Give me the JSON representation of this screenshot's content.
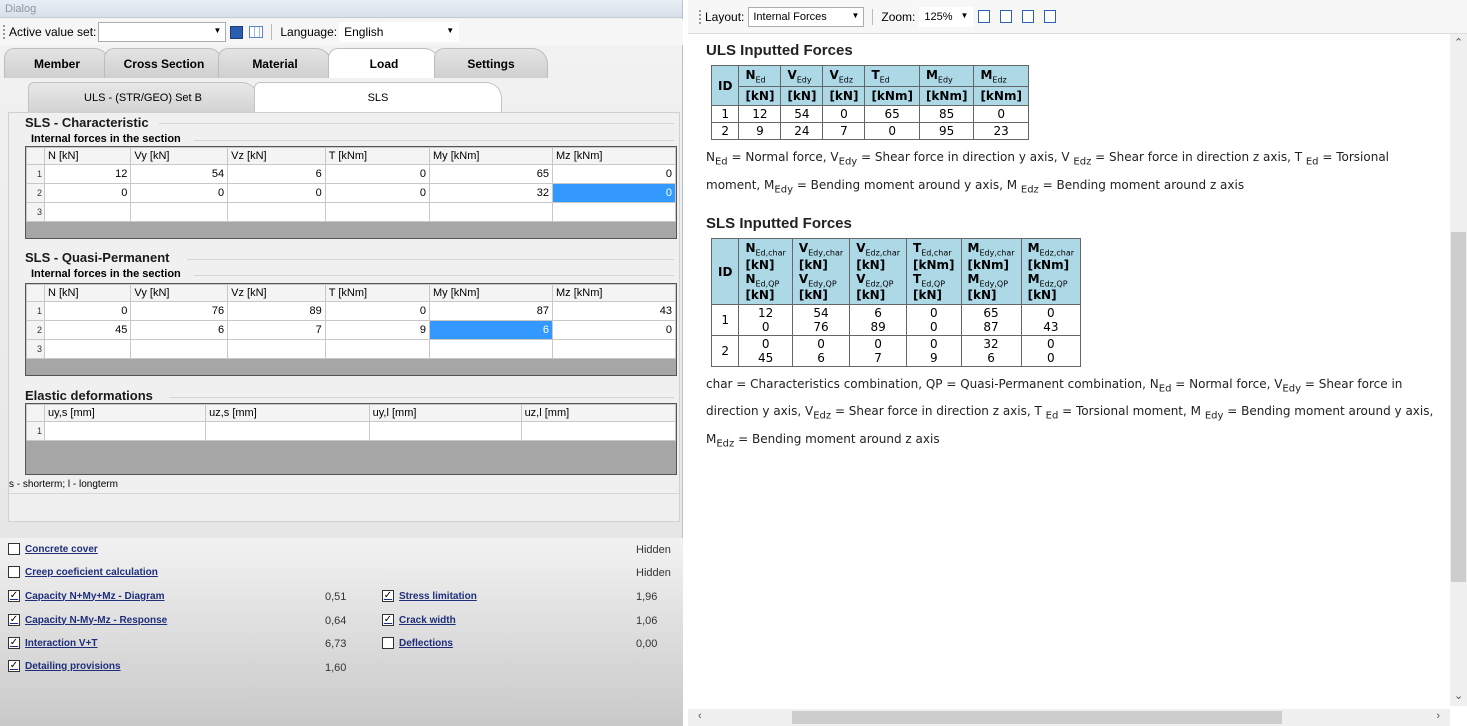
{
  "dialog_title": "Dialog",
  "toolbar": {
    "active_value_set_label": "Active value set:",
    "active_value_set": "",
    "language_label": "Language:",
    "language": "English"
  },
  "tabs": [
    "Member",
    "Cross Section",
    "Material",
    "Load",
    "Settings"
  ],
  "subtabs": [
    "ULS - (STR/GEO) Set B",
    "SLS"
  ],
  "sls_char": {
    "title": "SLS - Characteristic",
    "subtitle": "Internal forces in the section",
    "headers": [
      "N [kN]",
      "Vy [kN]",
      "Vz [kN]",
      "T [kNm]",
      "My [kNm]",
      "Mz [kNm]"
    ],
    "rows": [
      [
        "1",
        "12",
        "54",
        "6",
        "0",
        "65",
        "0"
      ],
      [
        "2",
        "0",
        "0",
        "0",
        "0",
        "32",
        "0"
      ],
      [
        "3",
        "",
        "",
        "",
        "",
        "",
        ""
      ]
    ]
  },
  "sls_qp": {
    "title": "SLS - Quasi-Permanent",
    "subtitle": "Internal forces in the section",
    "headers": [
      "N [kN]",
      "Vy [kN]",
      "Vz [kN]",
      "T [kNm]",
      "My [kNm]",
      "Mz [kNm]"
    ],
    "rows": [
      [
        "1",
        "0",
        "76",
        "89",
        "0",
        "87",
        "43"
      ],
      [
        "2",
        "45",
        "6",
        "7",
        "9",
        "6",
        "0"
      ],
      [
        "3",
        "",
        "",
        "",
        "",
        "",
        ""
      ]
    ]
  },
  "elastic": {
    "title": "Elastic deformations",
    "headers": [
      "uy,s [mm]",
      "uz,s [mm]",
      "uy,l [mm]",
      "uz,l [mm]"
    ],
    "rows": [
      [
        "1",
        "",
        "",
        "",
        ""
      ]
    ],
    "footnote": "s - shorterm; l - longterm"
  },
  "checks": {
    "concrete_cover": "Concrete cover",
    "concrete_cover_val": "Hidden",
    "creep": "Creep coeficient calculation",
    "creep_val": "Hidden",
    "capacity_diagram": "Capacity N+My+Mz - Diagram",
    "capacity_diagram_val": "0,51",
    "capacity_response": "Capacity N-My-Mz - Response",
    "capacity_response_val": "0,64",
    "interaction": "Interaction V+T",
    "interaction_val": "6,73",
    "detailing": "Detailing provisions",
    "detailing_val": "1,60",
    "stress": "Stress limitation",
    "stress_val": "1,96",
    "crack": "Crack width",
    "crack_val": "1,06",
    "deflections": "Deflections",
    "deflections_val": "0,00"
  },
  "right_toolbar": {
    "layout_label": "Layout:",
    "layout": "Internal Forces",
    "zoom_label": "Zoom:",
    "zoom": "125%"
  },
  "uls_title": "ULS Inputted Forces",
  "uls_rows": [
    [
      "1",
      "12",
      "54",
      "0",
      "65",
      "85",
      "0"
    ],
    [
      "2",
      "9",
      "24",
      "7",
      "0",
      "95",
      "23"
    ]
  ],
  "sls_title": "SLS Inputted Forces",
  "sls_rows": [
    {
      "id": "1",
      "char": [
        "12",
        "54",
        "6",
        "0",
        "65",
        "0"
      ],
      "qp": [
        "0",
        "76",
        "89",
        "0",
        "87",
        "43"
      ]
    },
    {
      "id": "2",
      "char": [
        "0",
        "0",
        "0",
        "0",
        "32",
        "0"
      ],
      "qp": [
        "45",
        "6",
        "7",
        "9",
        "6",
        "0"
      ]
    }
  ],
  "units": {
    "id": "ID",
    "kN": "[kN]",
    "kNm": "[kNm]"
  },
  "uls_note_1": "N",
  "uls_note_text": "= Normal force, V = Shear force in direction y axis, V = Shear force in direction z axis, T = Torsional moment, M = Bending moment around y axis, M = Bending moment around z axis",
  "char_note_prefix": "char = Characteristics combination, QP = Quasi-Permanent combination,"
}
